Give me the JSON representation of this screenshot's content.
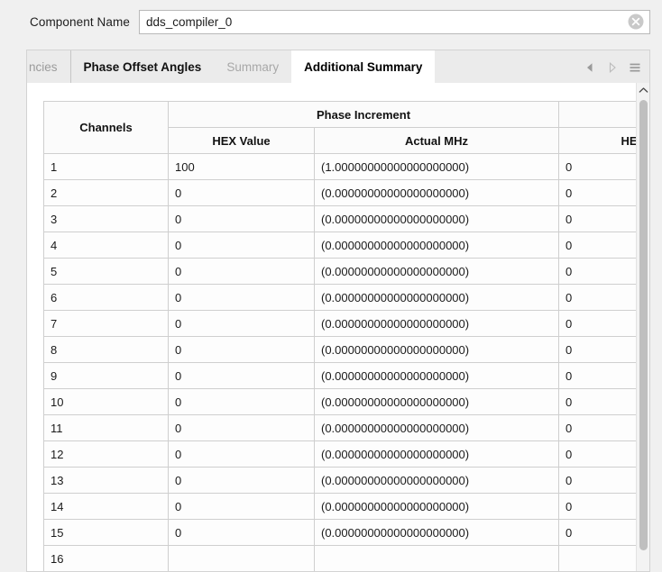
{
  "component": {
    "label": "Component Name",
    "value": "dds_compiler_0",
    "placeholder": "",
    "clear_icon": "clear-circle-x-icon"
  },
  "tabs": {
    "items": [
      {
        "label": "ncies",
        "state": "clipped"
      },
      {
        "label": "Phase Offset Angles",
        "state": "inactive-bold"
      },
      {
        "label": "Summary",
        "state": "disabled"
      },
      {
        "label": "Additional Summary",
        "state": "active"
      }
    ],
    "nav": {
      "prev_icon": "triangle-left-icon",
      "next_icon": "triangle-right-icon",
      "menu_icon": "hamburger-menu-icon"
    }
  },
  "table": {
    "group_headers": [
      {
        "label": "Channels",
        "span": 1,
        "rowspan": 2
      },
      {
        "label": "Phase Increment",
        "span": 2,
        "rowspan": 1
      },
      {
        "label": "",
        "span": 1,
        "rowspan": 1
      }
    ],
    "sub_headers": [
      "HEX Value",
      "Actual MHz",
      "HEX Valu"
    ],
    "columns": [
      "Channels",
      "HEX Value",
      "Actual MHz",
      "HEX Valu"
    ],
    "rows": [
      [
        "1",
        "100",
        "(1.00000000000000000000)",
        "0"
      ],
      [
        "2",
        "0",
        "(0.00000000000000000000)",
        "0"
      ],
      [
        "3",
        "0",
        "(0.00000000000000000000)",
        "0"
      ],
      [
        "4",
        "0",
        "(0.00000000000000000000)",
        "0"
      ],
      [
        "5",
        "0",
        "(0.00000000000000000000)",
        "0"
      ],
      [
        "6",
        "0",
        "(0.00000000000000000000)",
        "0"
      ],
      [
        "7",
        "0",
        "(0.00000000000000000000)",
        "0"
      ],
      [
        "8",
        "0",
        "(0.00000000000000000000)",
        "0"
      ],
      [
        "9",
        "0",
        "(0.00000000000000000000)",
        "0"
      ],
      [
        "10",
        "0",
        "(0.00000000000000000000)",
        "0"
      ],
      [
        "11",
        "0",
        "(0.00000000000000000000)",
        "0"
      ],
      [
        "12",
        "0",
        "(0.00000000000000000000)",
        "0"
      ],
      [
        "13",
        "0",
        "(0.00000000000000000000)",
        "0"
      ],
      [
        "14",
        "0",
        "(0.00000000000000000000)",
        "0"
      ],
      [
        "15",
        "0",
        "(0.00000000000000000000)",
        "0"
      ],
      [
        "16",
        "",
        "",
        ""
      ]
    ]
  },
  "scrollbar": {
    "up_icon": "chevron-up-icon",
    "orientation": "vertical"
  },
  "colors": {
    "window_bg": "#f0f0f0",
    "panel_bg": "#ffffff",
    "tabstrip_bg": "#ebebeb",
    "grid_line": "#cfcfcf",
    "text": "#1a1a1a",
    "disabled_text": "#a8a8a8",
    "scroll_thumb": "#bfbfbf"
  }
}
